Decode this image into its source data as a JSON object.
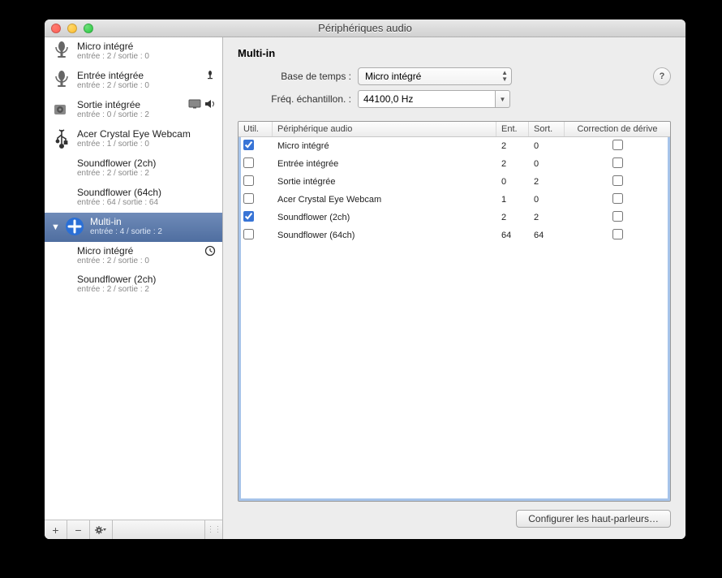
{
  "window_title": "Périphériques audio",
  "sidebar": {
    "devices": [
      {
        "name": "Micro intégré",
        "sub": "entrée : 2 / sortie : 0",
        "icon": "mic"
      },
      {
        "name": "Entrée intégrée",
        "sub": "entrée : 2 / sortie : 0",
        "icon": "mic",
        "badge_mic": true
      },
      {
        "name": "Sortie intégrée",
        "sub": "entrée : 0 / sortie : 2",
        "icon": "speaker",
        "badge_display": true,
        "badge_speaker": true
      },
      {
        "name": "Acer Crystal Eye Webcam",
        "sub": "entrée : 1 / sortie : 0",
        "icon": "usb"
      },
      {
        "name": "Soundflower (2ch)",
        "sub": "entrée : 2 / sortie : 2",
        "icon": "none"
      },
      {
        "name": "Soundflower (64ch)",
        "sub": "entrée : 64 / sortie : 64",
        "icon": "none"
      },
      {
        "name": "Multi-in",
        "sub": "entrée : 4 / sortie : 2",
        "icon": "plus",
        "selected": true,
        "expanded": true,
        "children": [
          {
            "name": "Micro intégré",
            "sub": "entrée : 2 / sortie : 0",
            "clock": true
          },
          {
            "name": "Soundflower (2ch)",
            "sub": "entrée : 2 / sortie : 2"
          }
        ]
      }
    ]
  },
  "main": {
    "title": "Multi-in",
    "clock_label": "Base de temps :",
    "clock_value": "Micro intégré",
    "rate_label": "Fréq. échantillon. :",
    "rate_value": "44100,0 Hz",
    "table": {
      "headers": {
        "use": "Util.",
        "device": "Périphérique audio",
        "in": "Ent.",
        "out": "Sort.",
        "drift": "Correction de dérive"
      },
      "rows": [
        {
          "use": true,
          "name": "Micro intégré",
          "in": "2",
          "out": "0",
          "drift": false
        },
        {
          "use": false,
          "name": "Entrée intégrée",
          "in": "2",
          "out": "0",
          "drift": false
        },
        {
          "use": false,
          "name": "Sortie intégrée",
          "in": "0",
          "out": "2",
          "drift": false
        },
        {
          "use": false,
          "name": "Acer Crystal Eye Webcam",
          "in": "1",
          "out": "0",
          "drift": false
        },
        {
          "use": true,
          "name": "Soundflower (2ch)",
          "in": "2",
          "out": "2",
          "drift": false
        },
        {
          "use": false,
          "name": "Soundflower (64ch)",
          "in": "64",
          "out": "64",
          "drift": false
        }
      ]
    },
    "configure_button": "Configurer les haut-parleurs…"
  }
}
